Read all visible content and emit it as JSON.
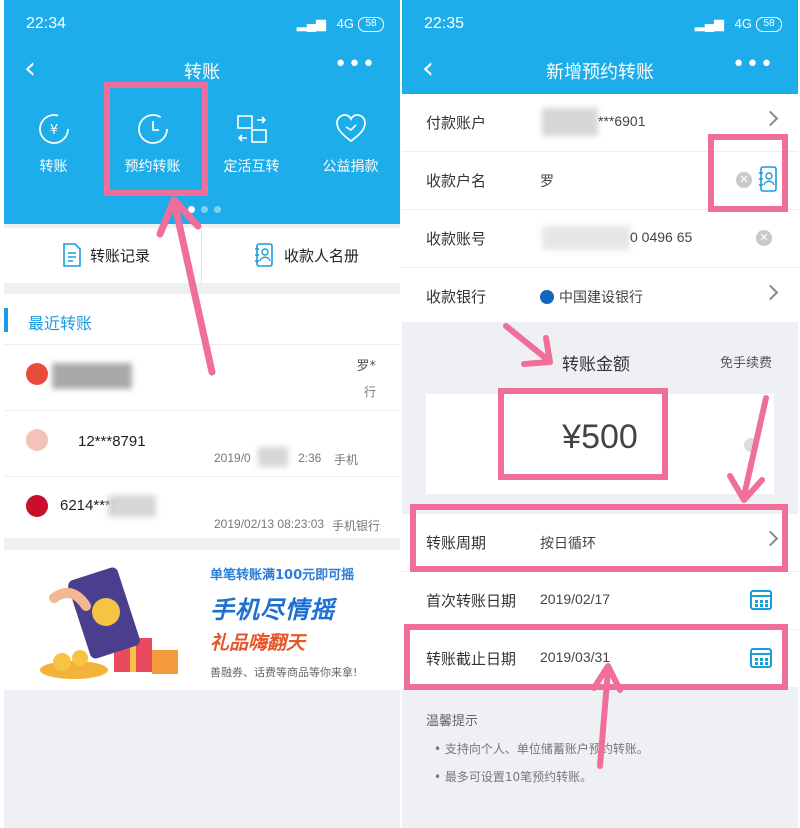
{
  "left": {
    "status": {
      "time": "22:34",
      "signal": "HD",
      "network": "4G",
      "battery": "58"
    },
    "nav": {
      "title": "转账"
    },
    "quick_actions": [
      {
        "label": "转账",
        "icon": "transfer-icon"
      },
      {
        "label": "预约转账",
        "icon": "clock-icon"
      },
      {
        "label": "定活互转",
        "icon": "exchange-icon"
      },
      {
        "label": "公益捐款",
        "icon": "heart-icon"
      }
    ],
    "tools": {
      "records": "转账记录",
      "payees": "收款人名册"
    },
    "recent": {
      "title": "最近转账",
      "items": [
        {
          "account": "",
          "name": "罗*",
          "meta_date": "",
          "meta_channel": "行"
        },
        {
          "account": "12***8791",
          "name": "",
          "meta_date": "2019/0",
          "meta_time": "2:36",
          "meta_channel": "手机"
        },
        {
          "account": "6214***8",
          "name": "",
          "meta_date": "2019/02/13 08:23:03",
          "meta_channel": "手机银行"
        }
      ]
    },
    "banner": {
      "line1": "单笔转账满100元即可摇",
      "line2": "手机尽情摇",
      "line3": "礼品嗨翻天",
      "line4": "善融券、话费等商品等你来拿!"
    }
  },
  "right": {
    "status": {
      "time": "22:35",
      "signal": "HD",
      "network": "4G",
      "battery": "58"
    },
    "nav": {
      "title": "新增预约转账"
    },
    "fields": {
      "payer_label": "付款账户",
      "payer_value": "***6901",
      "payee_name_label": "收款户名",
      "payee_name_value": "罗",
      "payee_account_label": "收款账号",
      "payee_account_value": "0 0496 65",
      "bank_label": "收款银行",
      "bank_value": "中国建设银行"
    },
    "amount": {
      "label": "转账金额",
      "fee": "免手续费",
      "value": "¥500"
    },
    "schedule": {
      "cycle_label": "转账周期",
      "cycle_value": "按日循环",
      "first_label": "首次转账日期",
      "first_value": "2019/02/17",
      "end_label": "转账截止日期",
      "end_value": "2019/03/31"
    },
    "tips": {
      "title": "温馨提示",
      "items": [
        "支持向个人、单位储蓄账户预约转账。",
        "最多可设置10笔预约转账。"
      ]
    }
  },
  "colors": {
    "header_blue": "#1cadea",
    "link_blue": "#1a9ce0",
    "highlight_pink": "#ef6f9a"
  }
}
